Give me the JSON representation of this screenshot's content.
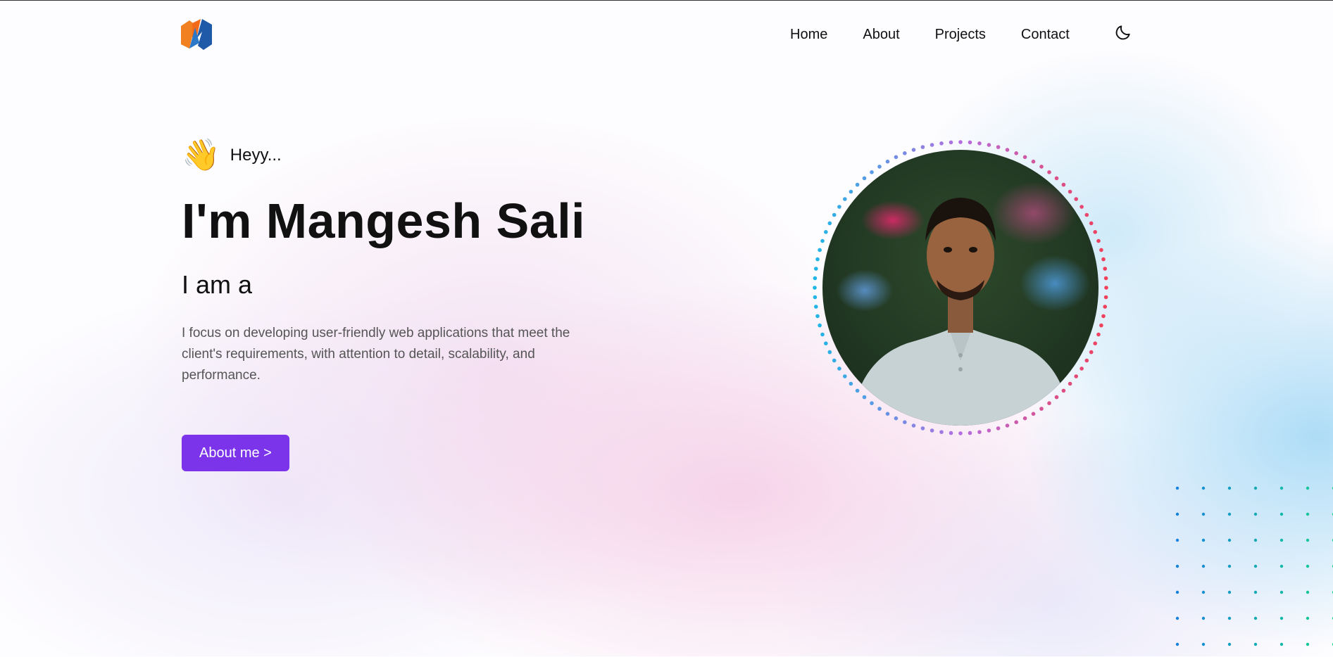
{
  "nav": {
    "links": [
      "Home",
      "About",
      "Projects",
      "Contact"
    ],
    "logo": "M-logo-icon",
    "theme_toggle": "moon-icon"
  },
  "hero": {
    "greeting": "Heyy...",
    "wave_emoji": "👋",
    "title": "I'm Mangesh Sali",
    "subtitle": "I am a",
    "description": "I focus on developing user-friendly web applications that meet the client's requirements, with attention to detail, scalability, and performance.",
    "cta_label": "About me >"
  },
  "colors": {
    "accent": "#7b34ea",
    "ring_start": "#1fb6e6",
    "ring_mid": "#b46ee0",
    "ring_end": "#f0405a"
  }
}
